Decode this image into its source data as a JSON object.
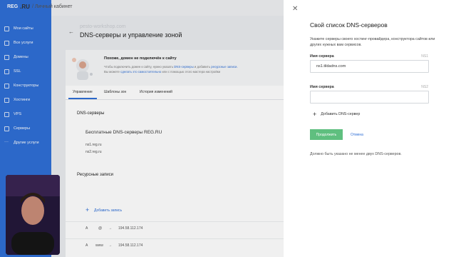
{
  "header": {
    "logo_reg": "REG",
    "logo_ru": ".RU",
    "cabinet": "/ Личный кабинет"
  },
  "sidebar": {
    "items": [
      {
        "label": "Мои сайты"
      },
      {
        "label": "Все услуги"
      },
      {
        "label": "Домены"
      },
      {
        "label": "SSL"
      },
      {
        "label": "Конструкторы"
      },
      {
        "label": "Хостинги"
      },
      {
        "label": "VPS"
      },
      {
        "label": "Серверы"
      },
      {
        "label": "Другие услуги"
      }
    ]
  },
  "main": {
    "domain": "pesto-workshop.com",
    "title": "DNS-серверы и управление зоной",
    "banner": {
      "title": "Похоже, домен не подключён к сайту",
      "text_1": "Чтобы подключить домен к сайту, нужно указать ",
      "link_1": "DNS-серверы",
      "text_2": " и добавить ",
      "link_2": "ресурсные записи.",
      "text_3": "Вы можете ",
      "link_3": "сделать это самостоятельно",
      "text_4": " или с помощью этого мастера настройки"
    },
    "tabs": [
      {
        "label": "Управление"
      },
      {
        "label": "Шаблоны зон"
      },
      {
        "label": "История изменений"
      }
    ],
    "dns_section_title": "DNS-серверы",
    "free_dns_label": "Бесплатные DNS-серверы REG.RU",
    "ns": [
      "ns1.reg.ru",
      "ns2.reg.ru"
    ],
    "records_title": "Ресурсные записи",
    "add_record": "Добавить запись",
    "records": [
      {
        "type": "A",
        "host": "@",
        "arrow": "→",
        "value": "194.58.112.174"
      },
      {
        "type": "A",
        "host": "www",
        "arrow": "→",
        "value": "194.58.112.174"
      }
    ]
  },
  "drawer": {
    "title": "Свой список DNS-серверов",
    "desc": "Укажите серверы своего хостинг-провайдера, конструктора сайтов или других нужных вам сервисов.",
    "fields": [
      {
        "label": "Имя сервера",
        "num": "NS1",
        "value": "ns1.tildadns.com",
        "placeholder": ""
      },
      {
        "label": "Имя сервера",
        "num": "NS2",
        "value": "",
        "placeholder": ""
      }
    ],
    "add_dns": "Добавить DNS-сервер",
    "continue": "Продолжить",
    "cancel": "Отмена",
    "hint": "Должно быть указано не менее двух DNS-серверов.",
    "close_icon": "close-icon"
  },
  "colors": {
    "sidebar": "#2f6fd6",
    "accent": "#2f6fd6",
    "continue_button": "#5fbf7f"
  }
}
